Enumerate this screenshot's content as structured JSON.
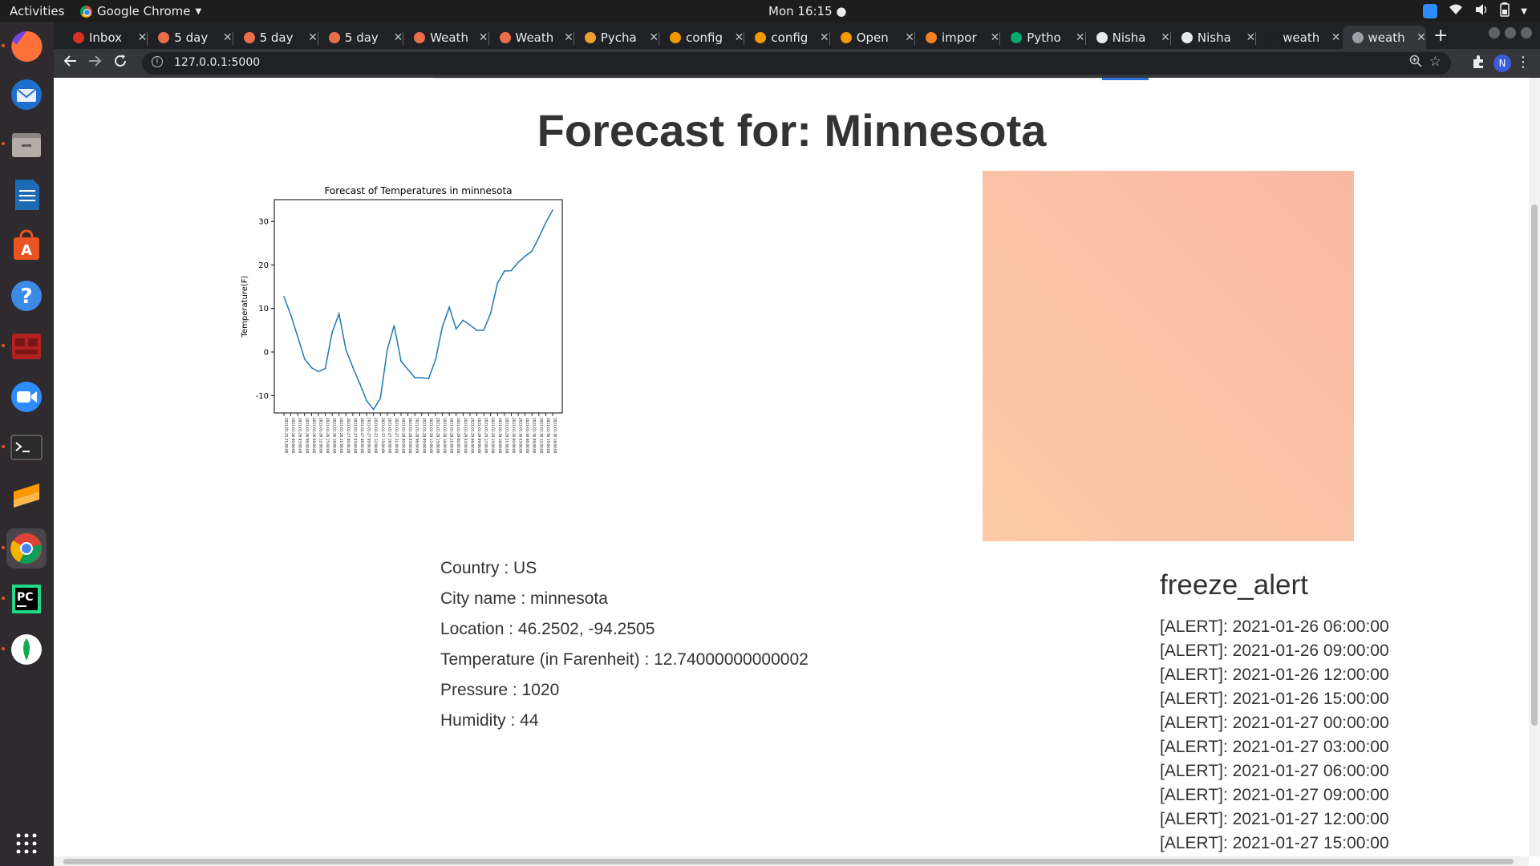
{
  "system": {
    "activities": "Activities",
    "app_name": "Google Chrome",
    "clock": "Mon 16:15 ●"
  },
  "browser": {
    "tabs": [
      {
        "label": "Inbox",
        "icon": "gmail-icon",
        "color": "#d93025"
      },
      {
        "label": "5 day",
        "icon": "openweather-icon",
        "color": "#eb6e4b"
      },
      {
        "label": "5 day",
        "icon": "openweather-icon",
        "color": "#eb6e4b"
      },
      {
        "label": "5 day",
        "icon": "openweather-icon",
        "color": "#eb6e4b"
      },
      {
        "label": "Weath",
        "icon": "openweather-icon",
        "color": "#eb6e4b"
      },
      {
        "label": "Weath",
        "icon": "openweather-icon",
        "color": "#eb6e4b"
      },
      {
        "label": "Pycha",
        "icon": "pycharm-icon",
        "color": "#f0a030"
      },
      {
        "label": "config",
        "icon": "document-icon",
        "color": "#f29900"
      },
      {
        "label": "config",
        "icon": "book-icon",
        "color": "#f29900"
      },
      {
        "label": "Open",
        "icon": "book-icon",
        "color": "#f29900"
      },
      {
        "label": "impor",
        "icon": "stackoverflow-icon",
        "color": "#f48024"
      },
      {
        "label": "Pytho",
        "icon": "w3-icon",
        "color": "#04aa6d"
      },
      {
        "label": "Nisha",
        "icon": "github-icon",
        "color": "#e8eaed"
      },
      {
        "label": "Nisha",
        "icon": "github-icon",
        "color": "#e8eaed"
      },
      {
        "label": "weath",
        "icon": "blank-icon",
        "color": "#202124"
      },
      {
        "label": "weath",
        "icon": "globe-icon",
        "color": "#9aa0a6"
      }
    ],
    "url": "127.0.0.1:5000",
    "profile_initial": "N"
  },
  "page": {
    "title": "Forecast for: Minnesota",
    "info": [
      "Country : US",
      "City name : minnesota",
      "Location : 46.2502, -94.2505",
      "Temperature (in Farenheit) : 12.74000000000002",
      "Pressure : 1020",
      "Humidity : 44"
    ],
    "alert_title": "freeze_alert",
    "alerts": [
      "[ALERT]: 2021-01-26 06:00:00",
      "[ALERT]: 2021-01-26 09:00:00",
      "[ALERT]: 2021-01-26 12:00:00",
      "[ALERT]: 2021-01-26 15:00:00",
      "[ALERT]: 2021-01-27 00:00:00",
      "[ALERT]: 2021-01-27 03:00:00",
      "[ALERT]: 2021-01-27 06:00:00",
      "[ALERT]: 2021-01-27 09:00:00",
      "[ALERT]: 2021-01-27 12:00:00",
      "[ALERT]: 2021-01-27 15:00:00"
    ],
    "photo_colors": [
      "#f9b9a1",
      "#fccaa6"
    ]
  },
  "chart_data": {
    "type": "line",
    "title": "Forecast of Temperatures in minnesota",
    "ylabel": "Temperature(F)",
    "xlabel": "",
    "ylim": [
      -14,
      35
    ],
    "yticks": [
      -10,
      0,
      10,
      20,
      30
    ],
    "line_color": "#1f77b4",
    "grid": false,
    "values": [
      12.7,
      8.5,
      3.5,
      -1.6,
      -3.6,
      -4.5,
      -3.8,
      4.5,
      8.8,
      0.5,
      -3.5,
      -7.2,
      -11.2,
      -13.2,
      -10.6,
      0.5,
      6.1,
      -2.1,
      -4.0,
      -5.9,
      -5.9,
      -6.1,
      -1.8,
      5.8,
      10.3,
      5.3,
      7.3,
      6.2,
      5.0,
      5.0,
      8.9,
      15.8,
      18.6,
      18.7,
      20.6,
      22.0,
      23.2,
      26.3,
      29.7,
      32.6
    ],
    "x_tick_labels": [
      "2021-01-25 21:00:00",
      "2021-01-26 00:00:00",
      "2021-01-26 03:00:00",
      "2021-01-26 06:00:00",
      "2021-01-26 09:00:00",
      "2021-01-26 12:00:00",
      "2021-01-26 15:00:00",
      "2021-01-26 18:00:00",
      "2021-01-26 21:00:00",
      "2021-01-27 00:00:00",
      "2021-01-27 03:00:00",
      "2021-01-27 06:00:00",
      "2021-01-27 09:00:00",
      "2021-01-27 12:00:00",
      "2021-01-27 15:00:00",
      "2021-01-27 18:00:00",
      "2021-01-27 21:00:00",
      "2021-01-28 00:00:00",
      "2021-01-28 03:00:00",
      "2021-01-28 06:00:00",
      "2021-01-28 09:00:00",
      "2021-01-28 12:00:00",
      "2021-01-28 15:00:00",
      "2021-01-28 18:00:00",
      "2021-01-28 21:00:00",
      "2021-01-29 00:00:00",
      "2021-01-29 03:00:00",
      "2021-01-29 06:00:00",
      "2021-01-29 09:00:00",
      "2021-01-29 12:00:00",
      "2021-01-29 15:00:00",
      "2021-01-29 18:00:00",
      "2021-01-29 21:00:00",
      "2021-01-30 00:00:00",
      "2021-01-30 03:00:00",
      "2021-01-30 06:00:00",
      "2021-01-30 09:00:00",
      "2021-01-30 12:00:00",
      "2021-01-30 15:00:00",
      "2021-01-30 18:00:00"
    ]
  }
}
